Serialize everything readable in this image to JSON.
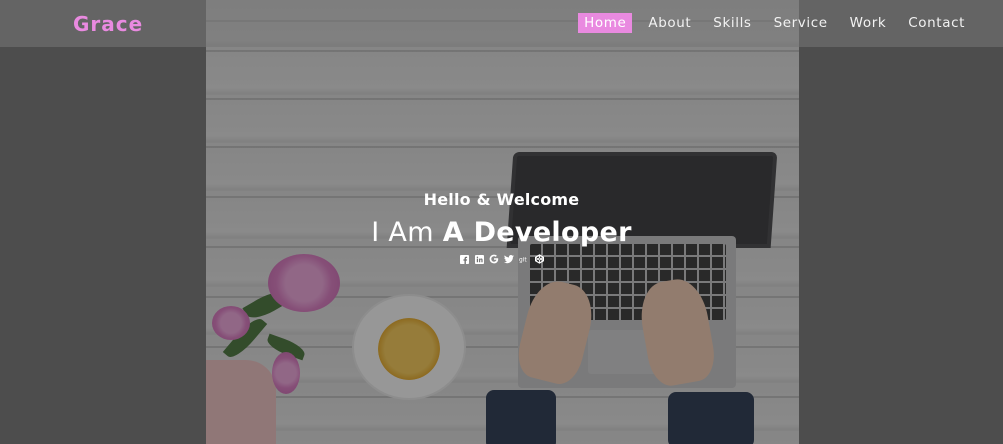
{
  "brand": {
    "name": "Grace",
    "color": "#e98ae0"
  },
  "nav": {
    "items": [
      {
        "label": "Home",
        "active": true
      },
      {
        "label": "About",
        "active": false
      },
      {
        "label": "Skills",
        "active": false
      },
      {
        "label": "Service",
        "active": false
      },
      {
        "label": "Work",
        "active": false
      },
      {
        "label": "Contact",
        "active": false
      }
    ]
  },
  "hero": {
    "greeting": "Hello & Welcome",
    "headline_prefix": "I Am",
    "headline_role": "A Developer",
    "social": [
      {
        "icon": "facebook-icon"
      },
      {
        "icon": "linkedin-icon"
      },
      {
        "icon": "google-icon"
      },
      {
        "icon": "twitter-icon"
      },
      {
        "icon": "git-icon"
      },
      {
        "icon": "codepen-icon"
      }
    ]
  }
}
